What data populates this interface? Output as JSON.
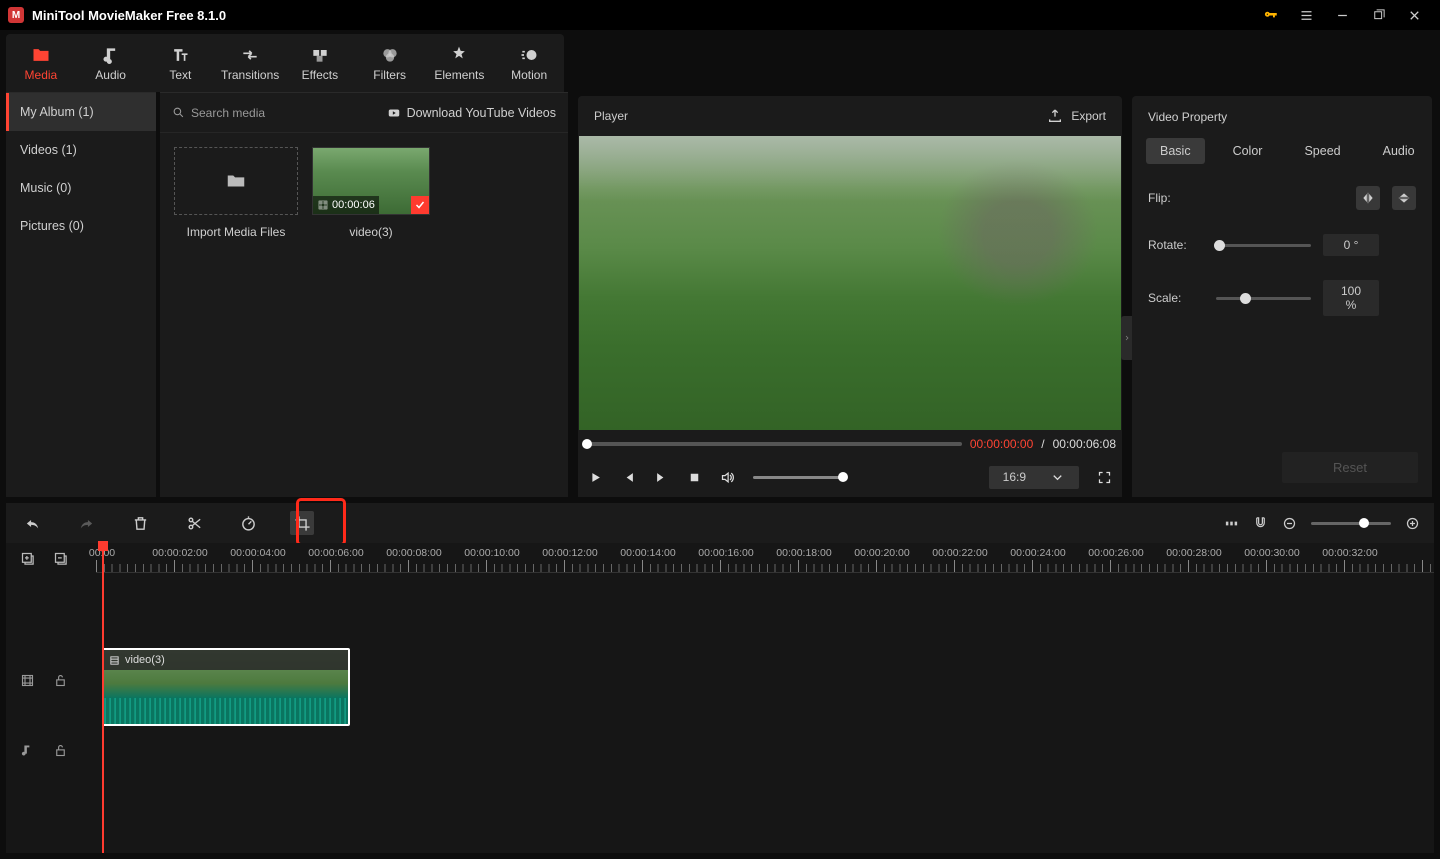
{
  "app": {
    "title": "MiniTool MovieMaker Free 8.1.0"
  },
  "tabs": {
    "media": "Media",
    "audio": "Audio",
    "text": "Text",
    "transitions": "Transitions",
    "effects": "Effects",
    "filters": "Filters",
    "elements": "Elements",
    "motion": "Motion"
  },
  "sidebar": {
    "album": "My Album (1)",
    "videos": "Videos (1)",
    "music": "Music (0)",
    "pictures": "Pictures (0)"
  },
  "mediaPanel": {
    "searchPlaceholder": "Search media",
    "downloadLink": "Download YouTube Videos",
    "importLabel": "Import Media Files",
    "clipDuration": "00:00:06",
    "clipName": "video(3)"
  },
  "player": {
    "title": "Player",
    "export": "Export",
    "current": "00:00:00:00",
    "sep": " / ",
    "total": "00:00:06:08",
    "aspect": "16:9"
  },
  "propPanel": {
    "title": "Video Property",
    "tabs": {
      "basic": "Basic",
      "color": "Color",
      "speed": "Speed",
      "audio": "Audio"
    },
    "flip": "Flip:",
    "rotate": "Rotate:",
    "rotateVal": "0 °",
    "scale": "Scale:",
    "scaleVal": "100 %",
    "reset": "Reset"
  },
  "tooltip": {
    "crop": "Crop"
  },
  "timeline": {
    "labels": [
      "00:00",
      "00:00:02:00",
      "00:00:04:00",
      "00:00:06:00",
      "00:00:08:00",
      "00:00:10:00",
      "00:00:12:00",
      "00:00:14:00",
      "00:00:16:00",
      "00:00:18:00",
      "00:00:20:00",
      "00:00:22:00",
      "00:00:24:00",
      "00:00:26:00",
      "00:00:28:00",
      "00:00:30:00",
      "00:00:32:00"
    ],
    "clipName": "video(3)"
  }
}
